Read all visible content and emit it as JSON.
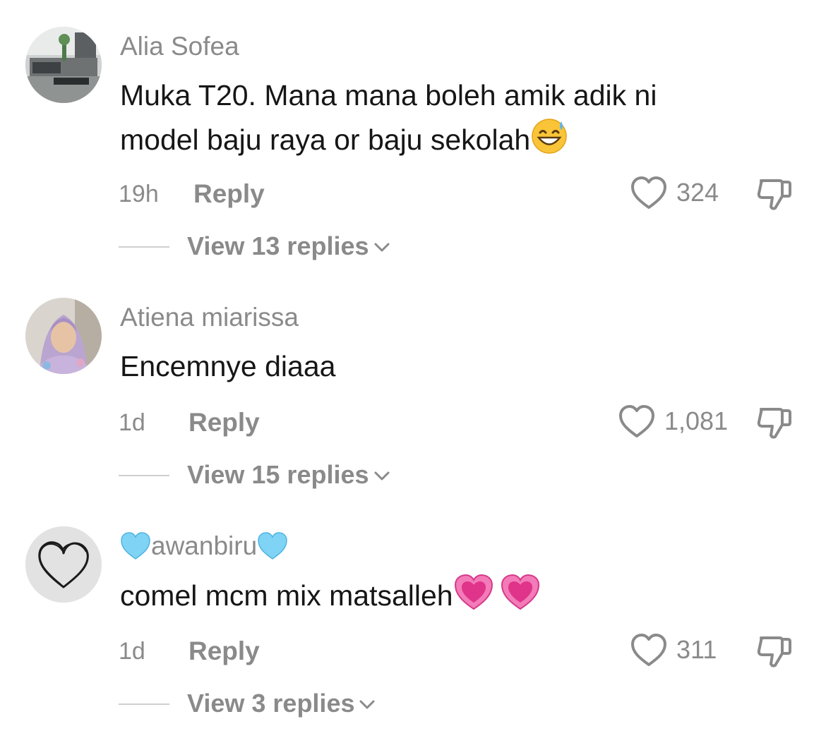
{
  "comments": [
    {
      "username": "Alia Sofea",
      "text_line1": "Muka T20. Mana mana boleh amik adik ni",
      "text_line2": "model baju raya or baju sekolah",
      "emoji": "grinning-face-with-sweat",
      "time": "19h",
      "reply_label": "Reply",
      "likes": "324",
      "view_replies": "View 13 replies"
    },
    {
      "username": "Atiena miarissa",
      "text": "Encemnye diaaa",
      "time": "1d",
      "reply_label": "Reply",
      "likes": "1,081",
      "view_replies": "View 15 replies"
    },
    {
      "username": "awanbiru",
      "username_emoji": "light-blue-heart",
      "text": "comel mcm mix matsalleh",
      "emoji": "growing-heart",
      "time": "1d",
      "reply_label": "Reply",
      "likes": "311",
      "view_replies": "View 3 replies"
    }
  ],
  "colors": {
    "text_primary": "#161616",
    "text_secondary": "#8a8a8a",
    "divider": "#cfcfcf",
    "heart_pink": "#e0338a",
    "heart_blue": "#7fd3f5"
  },
  "icons": {
    "like": "heart-outline-icon",
    "dislike": "thumbs-down-icon",
    "expand": "chevron-down-icon"
  }
}
